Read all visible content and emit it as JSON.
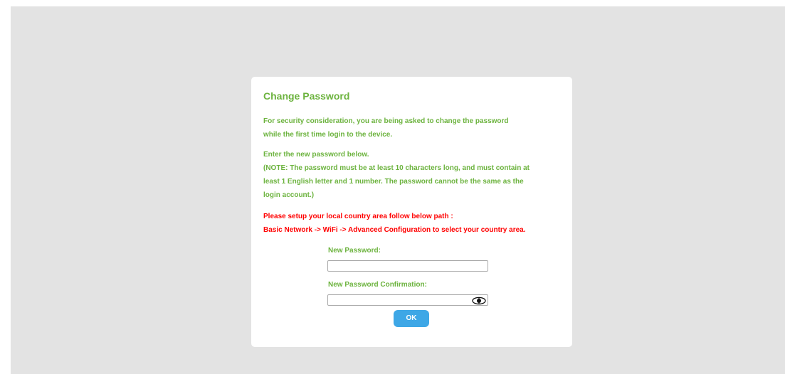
{
  "dialog": {
    "title": "Change Password",
    "intro": [
      "For security consideration, you are being asked to change the password",
      "while the first time login to the device."
    ],
    "instructions": [
      "Enter the new password below.",
      "(NOTE: The password must be at least 10 characters long, and must contain at",
      "least 1 English letter and 1 number. The password cannot be the same as the",
      "login account.)"
    ],
    "warning": [
      "Please setup your local country area follow below path :",
      "Basic Network -> WiFi -> Advanced Configuration to select your country area."
    ],
    "new_password": {
      "label": "New Password:",
      "value": ""
    },
    "confirm_password": {
      "label": "New Password Confirmation:",
      "value": "",
      "toggle_icon": "eye-icon"
    },
    "ok_label": "OK"
  },
  "colors": {
    "backdrop": "#e3e3e3",
    "text_green": "#6cb33e",
    "warning_red": "#ff0000",
    "button_blue": "#3ea7e6"
  }
}
